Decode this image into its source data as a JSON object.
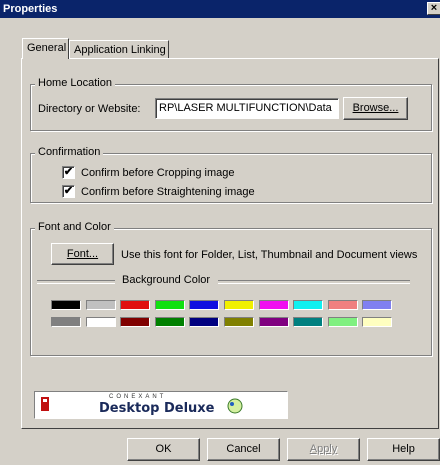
{
  "window": {
    "title": "Properties",
    "close_label": "×"
  },
  "tabs": [
    {
      "label": "General",
      "active": true
    },
    {
      "label": "Application Linking",
      "active": false
    }
  ],
  "home_location": {
    "group_label": "Home Location",
    "field_label": "Directory or Website:",
    "field_value": "RP\\LASER MULTIFUNCTION\\Data",
    "browse_label": "Browse..."
  },
  "confirmation": {
    "group_label": "Confirmation",
    "options": [
      {
        "label": "Confirm before Cropping image",
        "checked": true
      },
      {
        "label": "Confirm before Straightening image",
        "checked": true
      }
    ]
  },
  "font_color": {
    "group_label": "Font and Color",
    "font_button": "Font...",
    "font_description": "Use this font for Folder, List, Thumbnail and Document views",
    "background_label": "Background Color",
    "swatch_row1": [
      "#000000",
      "#c0c0c0",
      "#e01010",
      "#10e010",
      "#1010e0",
      "#f0f000",
      "#f010f0",
      "#10f0f0",
      "#f08080",
      "#8080f0"
    ],
    "swatch_row2": [
      "#808080",
      "#ffffff",
      "#800000",
      "#008000",
      "#000080",
      "#808000",
      "#800080",
      "#008080",
      "#80f080",
      "#ffffc0"
    ]
  },
  "logo": {
    "brand_small": "CONEXANT",
    "brand": "Desktop Deluxe"
  },
  "buttons": {
    "ok": "OK",
    "cancel": "Cancel",
    "apply": "Apply",
    "help": "Help"
  }
}
